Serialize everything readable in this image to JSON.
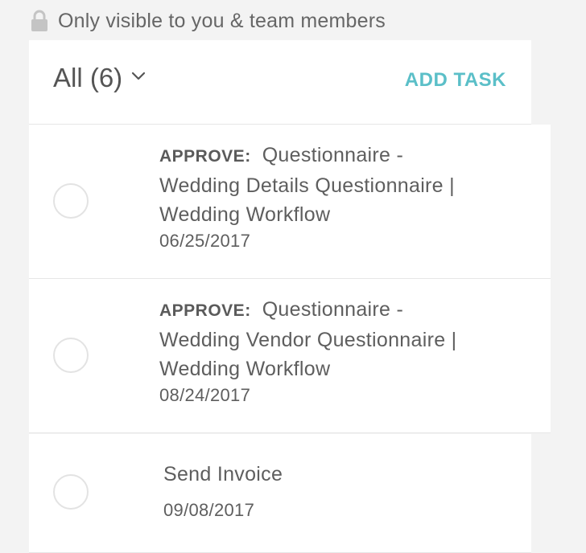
{
  "visibility_note": "Only visible to you & team members",
  "header": {
    "filter_label": "All (6)",
    "add_task_label": "ADD TASK"
  },
  "tasks": [
    {
      "action": "APPROVE:",
      "title": "Questionnaire - Wedding Details Questionnaire | Wedding Workflow",
      "date": "06/25/2017"
    },
    {
      "action": "APPROVE:",
      "title": "Questionnaire - Wedding Vendor Questionnaire | Wedding Workflow",
      "date": "08/24/2017"
    },
    {
      "action": "",
      "title": "Send Invoice",
      "date": "09/08/2017"
    }
  ],
  "colors": {
    "accent": "#5bbfc8",
    "background": "#f3f3f3",
    "text": "#5a5a5a"
  }
}
